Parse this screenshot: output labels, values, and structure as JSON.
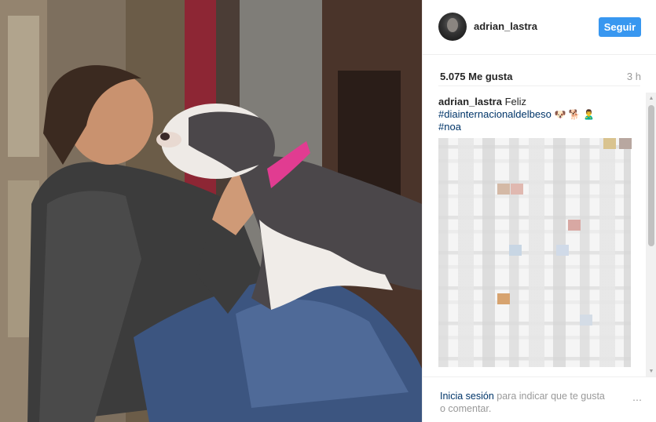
{
  "post": {
    "username": "adrian_lastra",
    "follow_label": "Seguir",
    "likes": "5.075 Me gusta",
    "time_ago": "3 h",
    "caption": {
      "username": "adrian_lastra",
      "text": "Feliz",
      "hashtag1": "#diainternacionaldelbeso",
      "emojis": "🐶 🐕 🙎‍♂",
      "hashtag2": "#noa"
    }
  },
  "footer": {
    "login_link": "Inicia sesión",
    "login_text": "para indicar que te gusta o comentar.",
    "more_icon": "⋯"
  },
  "icons": {
    "scroll_up": "▲",
    "scroll_down": "▼"
  }
}
